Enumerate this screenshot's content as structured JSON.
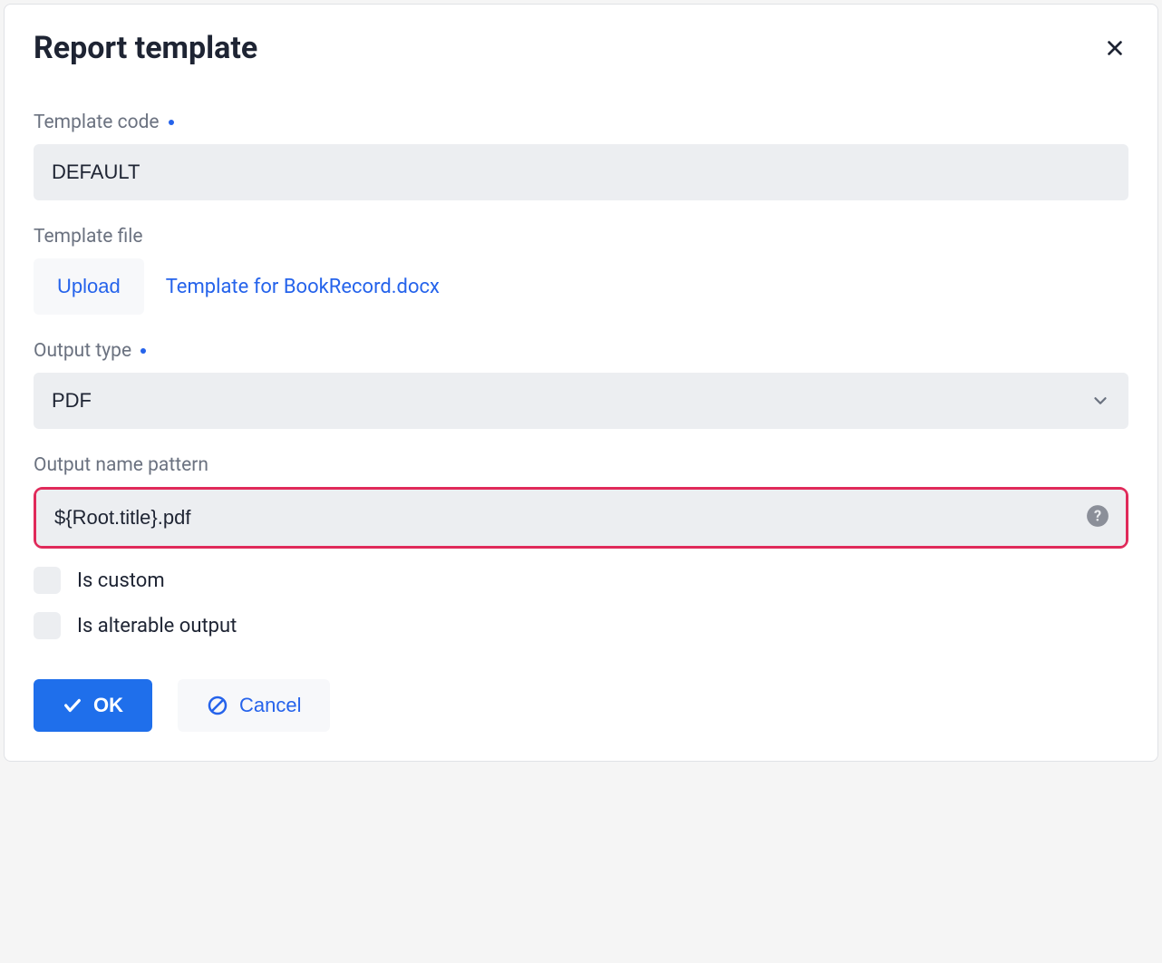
{
  "dialog": {
    "title": "Report template"
  },
  "fields": {
    "template_code": {
      "label": "Template code",
      "value": "DEFAULT",
      "required": true
    },
    "template_file": {
      "label": "Template file",
      "upload_label": "Upload",
      "file_name": "Template for BookRecord.docx"
    },
    "output_type": {
      "label": "Output type",
      "value": "PDF",
      "required": true
    },
    "output_name_pattern": {
      "label": "Output name pattern",
      "value": "${Root.title}.pdf"
    },
    "is_custom": {
      "label": "Is custom",
      "checked": false
    },
    "is_alterable": {
      "label": "Is alterable output",
      "checked": false
    }
  },
  "buttons": {
    "ok": "OK",
    "cancel": "Cancel"
  }
}
